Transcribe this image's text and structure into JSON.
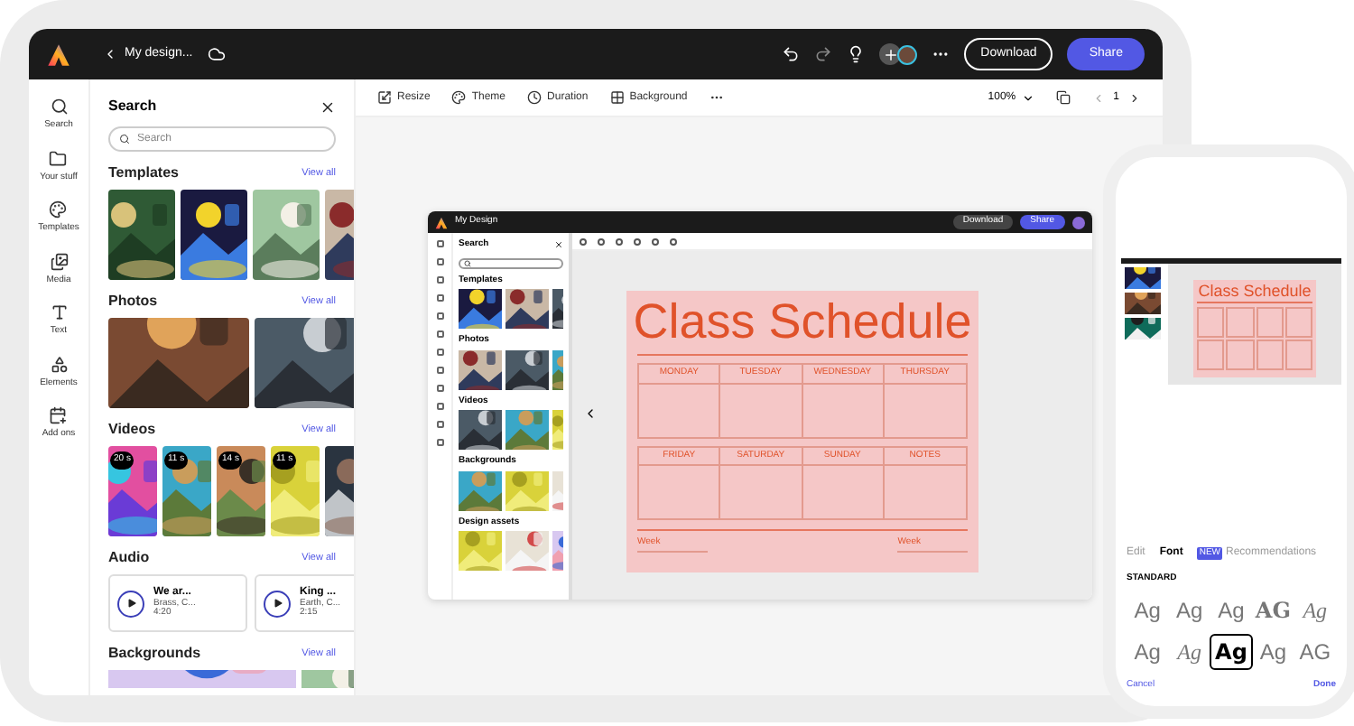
{
  "app": {
    "title": "My design...",
    "download": "Download",
    "share": "Share"
  },
  "rail": [
    {
      "label": "Search"
    },
    {
      "label": "Your stuff"
    },
    {
      "label": "Templates"
    },
    {
      "label": "Media"
    },
    {
      "label": "Text"
    },
    {
      "label": "Elements"
    },
    {
      "label": "Add ons"
    }
  ],
  "panel": {
    "title": "Search",
    "search_placeholder": "Search",
    "sections": [
      {
        "kind": "templates",
        "title": "Templates",
        "view_all": "View all"
      },
      {
        "kind": "photos",
        "title": "Photos",
        "view_all": "View all"
      },
      {
        "kind": "videos",
        "title": "Videos",
        "view_all": "View all",
        "items": [
          {
            "duration": "20 s"
          },
          {
            "duration": "11 s"
          },
          {
            "duration": "14 s"
          },
          {
            "duration": "11 s"
          }
        ]
      },
      {
        "kind": "audio",
        "title": "Audio",
        "view_all": "View all",
        "items": [
          {
            "title": "We ar...",
            "artist": "Brass, C...",
            "length": "4:20"
          },
          {
            "title": "King ...",
            "artist": "Earth, C...",
            "length": "2:15"
          }
        ]
      },
      {
        "kind": "backgrounds",
        "title": "Backgrounds",
        "view_all": "View all"
      }
    ]
  },
  "toolbar": {
    "items": [
      {
        "label": "Resize"
      },
      {
        "label": "Theme"
      },
      {
        "label": "Duration"
      },
      {
        "label": "Background"
      }
    ],
    "zoom": "100%",
    "page": "1"
  },
  "mini_app": {
    "title": "My Design",
    "download": "Download",
    "share": "Share",
    "panel_title": "Search",
    "sections": [
      {
        "title": "Templates"
      },
      {
        "title": "Photos"
      },
      {
        "title": "Videos"
      },
      {
        "title": "Backgrounds"
      },
      {
        "title": "Design assets"
      }
    ]
  },
  "schedule": {
    "title": "Class Schedule",
    "rows": [
      [
        "MONDAY",
        "TUESDAY",
        "WEDNESDAY",
        "THURSDAY"
      ],
      [
        "FRIDAY",
        "SATURDAY",
        "SUNDAY",
        "NOTES"
      ]
    ],
    "footer": [
      "Week",
      "Week"
    ]
  },
  "phone": {
    "preview_title": "Class Schedule",
    "tabs": [
      {
        "label": "Edit",
        "selected": false
      },
      {
        "label": "Font",
        "selected": true
      },
      {
        "label": "Recommendations",
        "badge": "NEW",
        "selected": false
      }
    ],
    "section": "STANDARD",
    "fonts": [
      {
        "sample": "Ag",
        "kind": "light",
        "selected": false
      },
      {
        "sample": "Ag",
        "kind": "light",
        "selected": false
      },
      {
        "sample": "Ag",
        "kind": "light",
        "selected": false
      },
      {
        "sample": "AG",
        "kind": "serif",
        "selected": false
      },
      {
        "sample": "Ag",
        "kind": "script",
        "selected": false
      },
      {
        "sample": "Ag",
        "kind": "light",
        "selected": false
      },
      {
        "sample": "Ag",
        "kind": "script",
        "selected": false
      },
      {
        "sample": "Ag",
        "kind": "bold",
        "selected": true
      },
      {
        "sample": "Ag",
        "kind": "light",
        "selected": false
      },
      {
        "sample": "AG",
        "kind": "light",
        "selected": false
      }
    ],
    "cancel": "Cancel",
    "done": "Done"
  }
}
